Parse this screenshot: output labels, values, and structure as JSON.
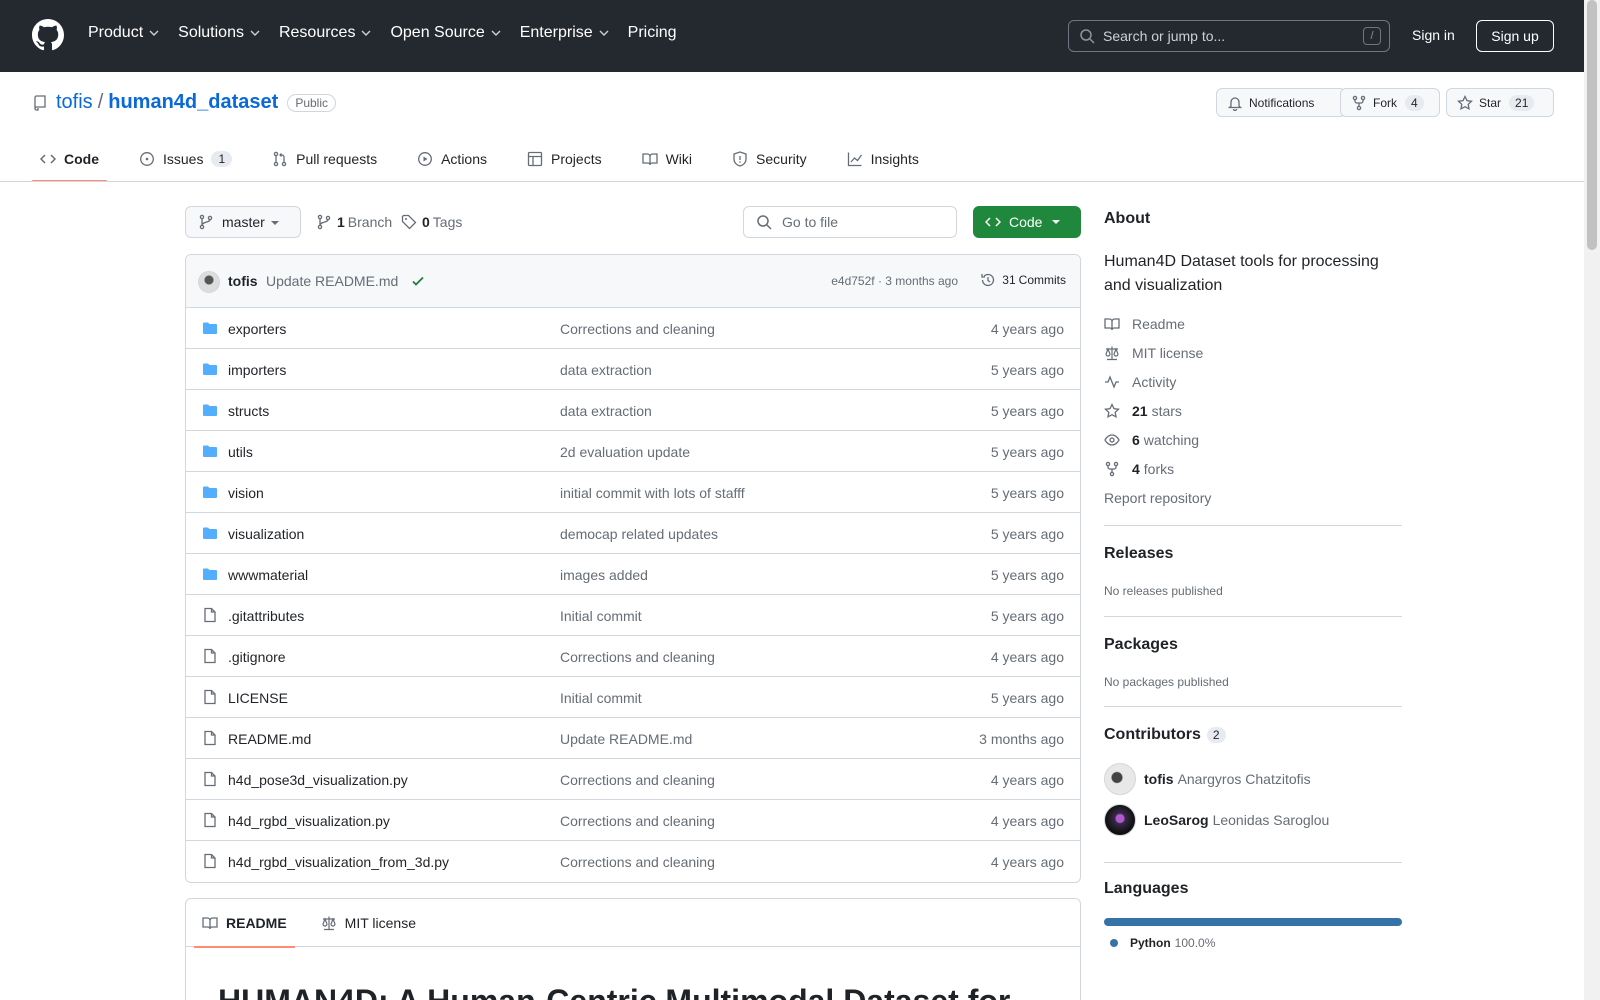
{
  "header": {
    "nav": [
      "Product",
      "Solutions",
      "Resources",
      "Open Source",
      "Enterprise",
      "Pricing"
    ],
    "search_placeholder": "Search or jump to...",
    "search_shortcut": "/",
    "sign_in": "Sign in",
    "sign_up": "Sign up"
  },
  "repo": {
    "owner": "tofis",
    "separator": "/",
    "name": "human4d_dataset",
    "visibility": "Public",
    "notifications_label": "Notifications",
    "fork_label": "Fork",
    "fork_count": "4",
    "star_label": "Star",
    "star_count": "21"
  },
  "tabs": [
    {
      "label": "Code",
      "icon": "code-icon"
    },
    {
      "label": "Issues",
      "count": "1",
      "icon": "issue-icon"
    },
    {
      "label": "Pull requests",
      "icon": "pull-request-icon"
    },
    {
      "label": "Actions",
      "icon": "play-icon"
    },
    {
      "label": "Projects",
      "icon": "table-icon"
    },
    {
      "label": "Wiki",
      "icon": "book-icon"
    },
    {
      "label": "Security",
      "icon": "shield-icon"
    },
    {
      "label": "Insights",
      "icon": "graph-icon"
    }
  ],
  "file_nav": {
    "branch": "master",
    "branch_count": "1",
    "branch_label": "Branch",
    "tag_count": "0",
    "tag_label": "Tags",
    "goto_file": "Go to file",
    "code_button": "Code"
  },
  "latest_commit": {
    "author": "tofis",
    "message": "Update README.md",
    "sha_age": "e4d752f · 3 months ago",
    "commits_count": "31",
    "commits_label": "Commits"
  },
  "files": [
    {
      "name": "exporters",
      "type": "folder",
      "message": "Corrections and cleaning",
      "age": "4 years ago"
    },
    {
      "name": "importers",
      "type": "folder",
      "message": "data extraction",
      "age": "5 years ago"
    },
    {
      "name": "structs",
      "type": "folder",
      "message": "data extraction",
      "age": "5 years ago"
    },
    {
      "name": "utils",
      "type": "folder",
      "message": "2d evaluation update",
      "age": "5 years ago"
    },
    {
      "name": "vision",
      "type": "folder",
      "message": "initial commit with lots of stafff",
      "age": "5 years ago"
    },
    {
      "name": "visualization",
      "type": "folder",
      "message": "democap related updates",
      "age": "5 years ago"
    },
    {
      "name": "wwwmaterial",
      "type": "folder",
      "message": "images added",
      "age": "5 years ago"
    },
    {
      "name": ".gitattributes",
      "type": "file",
      "message": "Initial commit",
      "age": "5 years ago"
    },
    {
      "name": ".gitignore",
      "type": "file",
      "message": "Corrections and cleaning",
      "age": "4 years ago"
    },
    {
      "name": "LICENSE",
      "type": "file",
      "message": "Initial commit",
      "age": "5 years ago"
    },
    {
      "name": "README.md",
      "type": "file",
      "message": "Update README.md",
      "age": "3 months ago"
    },
    {
      "name": "h4d_pose3d_visualization.py",
      "type": "file",
      "message": "Corrections and cleaning",
      "age": "4 years ago"
    },
    {
      "name": "h4d_rgbd_visualization.py",
      "type": "file",
      "message": "Corrections and cleaning",
      "age": "4 years ago"
    },
    {
      "name": "h4d_rgbd_visualization_from_3d.py",
      "type": "file",
      "message": "Corrections and cleaning",
      "age": "4 years ago"
    }
  ],
  "readme": {
    "tab_readme": "README",
    "tab_license": "MIT license",
    "heading": "HUMAN4D: A Human-Centric Multimodal Dataset for"
  },
  "about": {
    "title": "About",
    "description": "Human4D Dataset tools for processing and visualization",
    "readme": "Readme",
    "license": "MIT license",
    "activity": "Activity",
    "stars_count": "21",
    "stars_label": "stars",
    "watching_count": "6",
    "watching_label": "watching",
    "forks_count": "4",
    "forks_label": "forks",
    "report": "Report repository"
  },
  "releases": {
    "title": "Releases",
    "empty": "No releases published"
  },
  "packages": {
    "title": "Packages",
    "empty": "No packages published"
  },
  "contributors": {
    "title": "Contributors",
    "count": "2",
    "list": [
      {
        "login": "tofis",
        "name": "Anargyros Chatzitofis"
      },
      {
        "login": "LeoSarog",
        "name": "Leonidas Saroglou"
      }
    ]
  },
  "languages": {
    "title": "Languages",
    "list": [
      {
        "name": "Python",
        "percent": "100.0%",
        "share": 100,
        "color": "#3572A5"
      }
    ]
  },
  "colors": {
    "accent": "#0969da",
    "primary_button": "#1f883d",
    "selected_tab": "#fd8c73",
    "header_bg": "#24292f"
  }
}
